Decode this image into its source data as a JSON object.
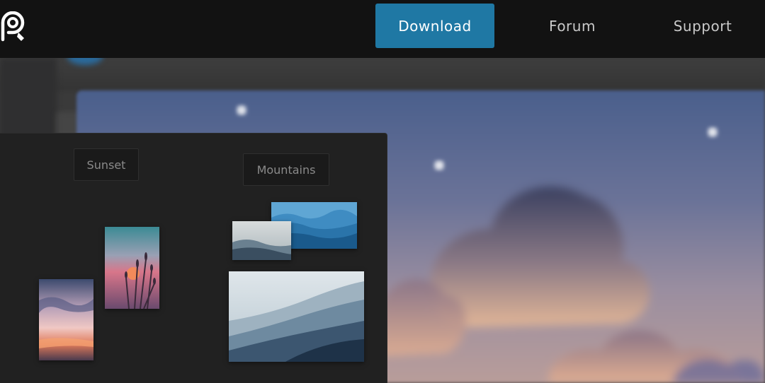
{
  "nav": {
    "logo_icon": "pixelfed-logo-icon",
    "download_label": "Download",
    "forum_label": "Forum",
    "support_label": "Support",
    "accent_color": "#1f78a4"
  },
  "collections": {
    "sunset": {
      "label": "Sunset",
      "photos": [
        "reeds-sunset-photo",
        "cloudy-sunset-photo"
      ]
    },
    "mountains": {
      "label": "Mountains",
      "photos": [
        "blue-ridges-photo",
        "foggy-hills-photo",
        "misty-mountain-photo"
      ]
    }
  },
  "background": {
    "illustration": "night-sky-clouds-illustration"
  }
}
